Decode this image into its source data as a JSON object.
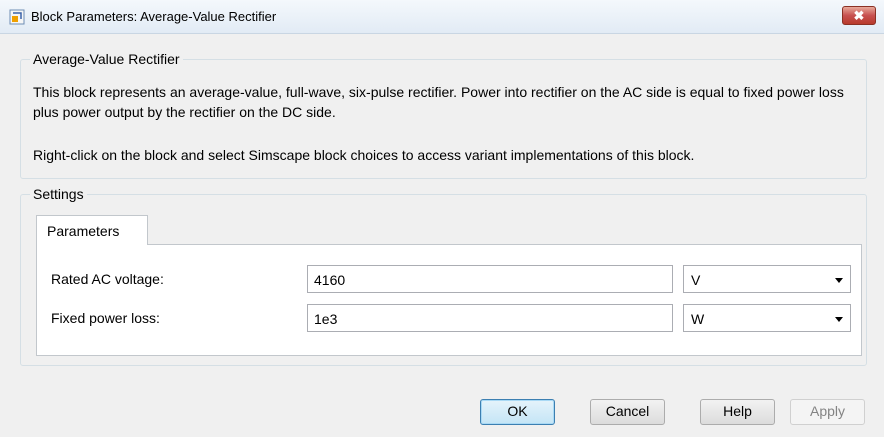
{
  "window": {
    "title": "Block Parameters: Average-Value Rectifier",
    "close_label": "✖"
  },
  "description": {
    "group_label": "Average-Value Rectifier",
    "line1": "This block represents an average-value, full-wave, six-pulse rectifier. Power into rectifier on the AC side is equal to fixed power loss plus power output by the rectifier on the DC side.",
    "line2": "Right-click on the block and select Simscape block choices to access variant implementations of this block."
  },
  "settings": {
    "group_label": "Settings",
    "tab_label": "Parameters",
    "params": [
      {
        "label": "Rated AC voltage:",
        "value": "4160",
        "unit": "V"
      },
      {
        "label": "Fixed power loss:",
        "value": "1e3",
        "unit": "W"
      }
    ]
  },
  "buttons": {
    "ok": "OK",
    "cancel": "Cancel",
    "help": "Help",
    "apply": "Apply"
  },
  "colors": {
    "close_button": "#c75050",
    "accent": "#3c7fb1"
  }
}
